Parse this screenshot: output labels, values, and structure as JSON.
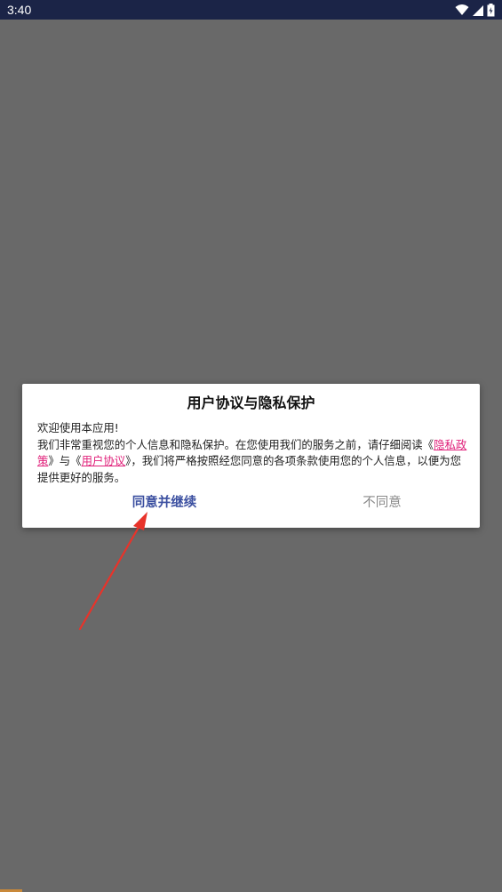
{
  "status_bar": {
    "time": "3:40",
    "icons": [
      "wifi-icon",
      "cell-signal-icon",
      "battery-icon"
    ]
  },
  "dialog": {
    "title": "用户协议与隐私保护",
    "greeting": "欢迎使用本应用!",
    "body_prefix": "我们非常重视您的个人信息和隐私保护。在您使用我们的服务之前，请仔细阅读《",
    "privacy_link": "隐私政策",
    "middle_text": "》与《",
    "terms_link": "用户协议",
    "body_suffix": "》，我们将严格按照经您同意的各项条款使用您的个人信息，以便为您提供更好的服务。",
    "agree_button": "同意并继续",
    "disagree_button": "不同意"
  },
  "colors": {
    "background_overlay": "#696969",
    "status_bar": "#1b2447",
    "link": "#e0207a",
    "agree": "#3b4fa0",
    "disagree": "#8a8a8a",
    "annotation_arrow": "#e8332a"
  }
}
